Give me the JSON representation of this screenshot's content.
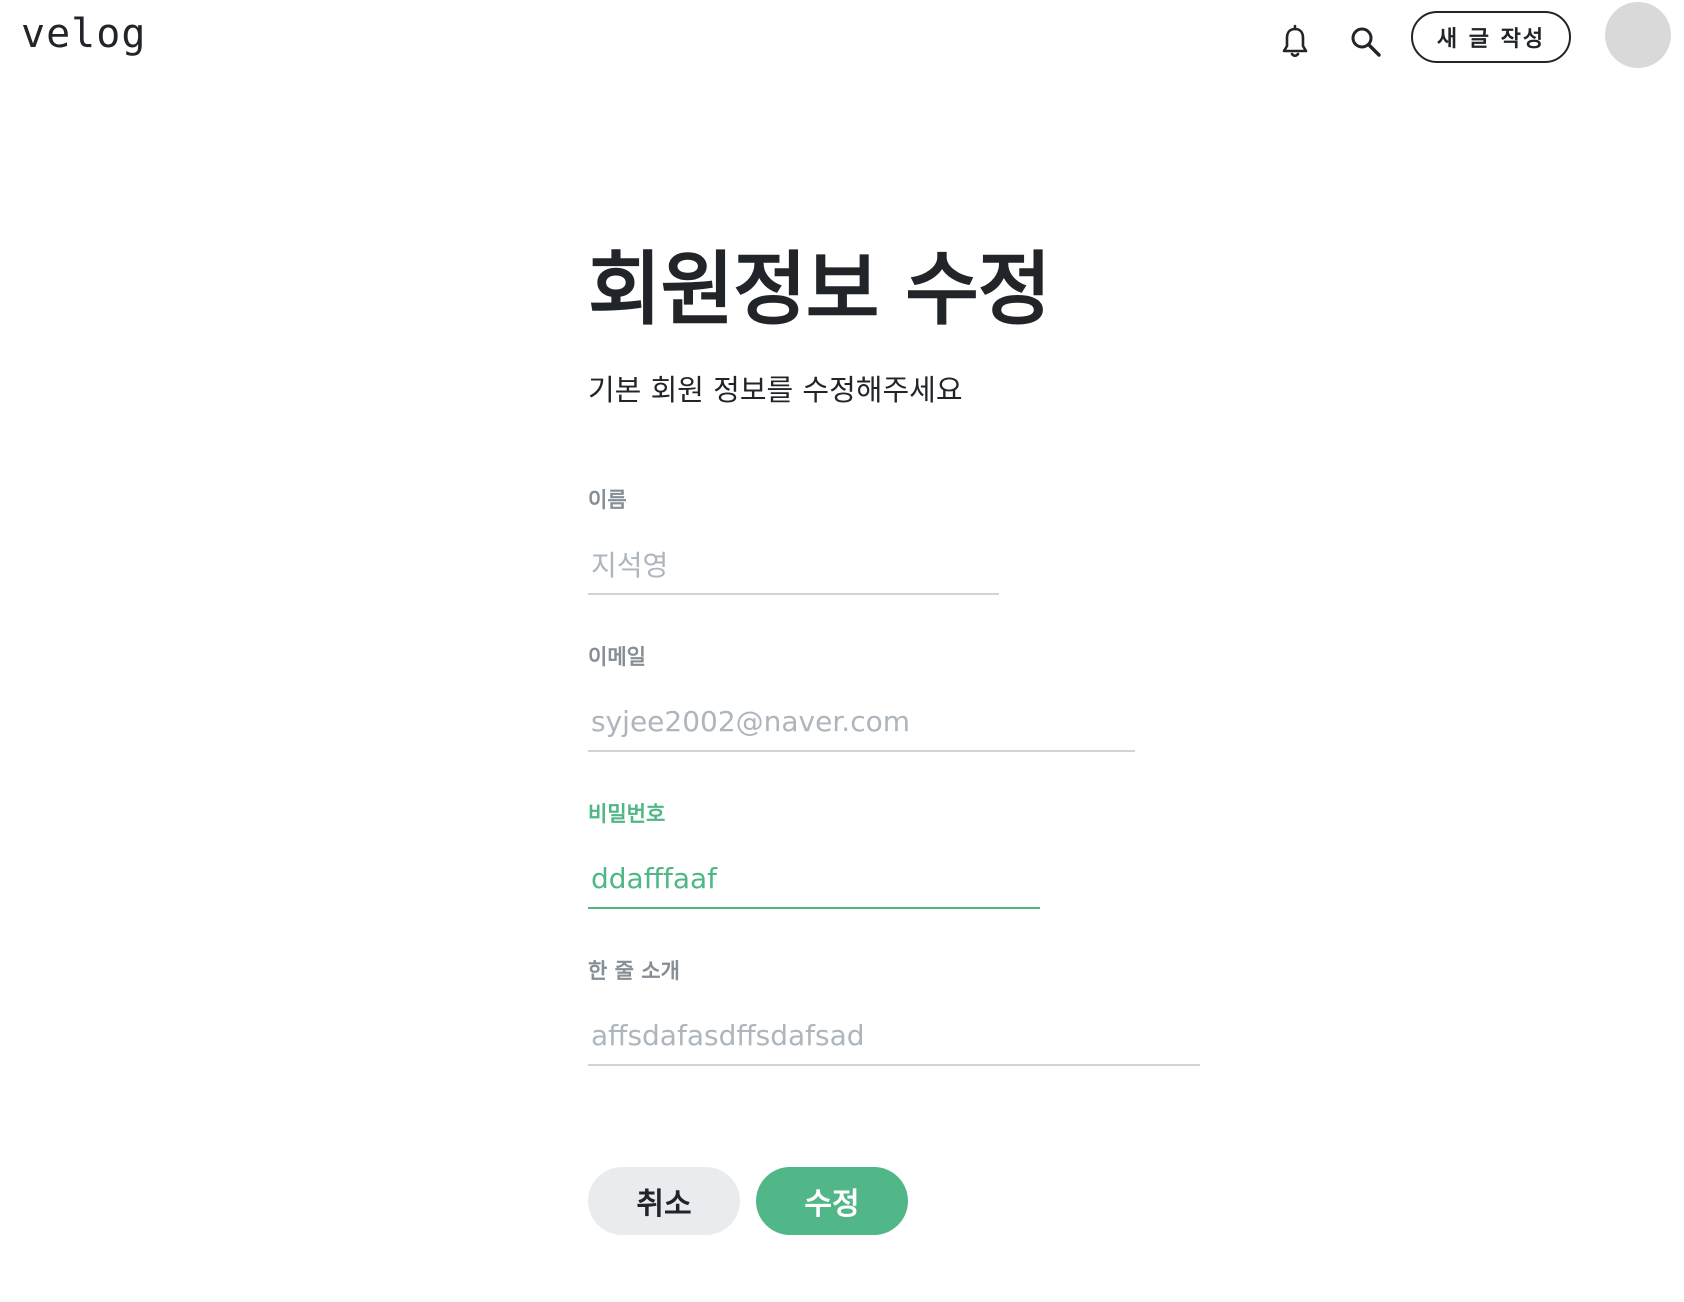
{
  "header": {
    "logo": "velog",
    "write_button": "새 글 작성",
    "icons": [
      "bell-icon",
      "search-icon"
    ]
  },
  "main": {
    "title": "회원정보 수정",
    "subtitle": "기본 회원 정보를 수정해주세요"
  },
  "form": {
    "name": {
      "label": "이름",
      "value": "지석영"
    },
    "email": {
      "label": "이메일",
      "value": "syjee2002@naver.com"
    },
    "password": {
      "label": "비밀번호",
      "value": "ddafffaaf"
    },
    "bio": {
      "label": "한 줄 소개",
      "value": "affsdafasdffsdafsad"
    }
  },
  "actions": {
    "cancel_label": "취소",
    "submit_label": "수정"
  },
  "colors": {
    "accent": "#4fb685",
    "submit_bg": "#52b788",
    "cancel_bg": "#e9ecef",
    "text": "#212529",
    "muted": "#868e96",
    "avatar": "#d9d9d9"
  }
}
